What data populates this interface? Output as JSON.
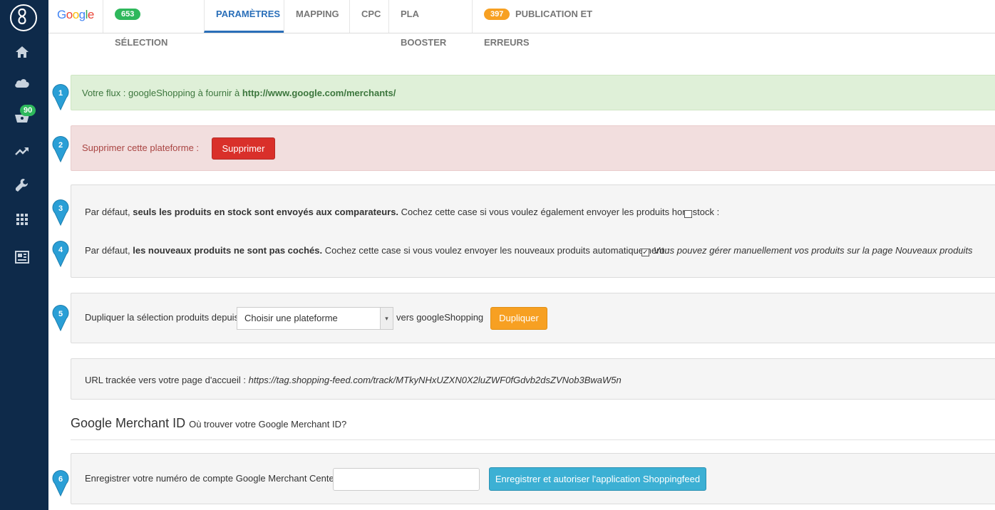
{
  "sidebar": {
    "cart_badge": "90",
    "icons": [
      "logo-icon",
      "home-icon",
      "cloud-icon",
      "basket-icon",
      "trending-icon",
      "wrench-icon",
      "apps-icon",
      "news-icon"
    ]
  },
  "topbar": {
    "logo": "Google",
    "tabs": [
      {
        "count": "653",
        "count_color": "#2eb85c",
        "label": "SÉLECTION"
      },
      {
        "label": "PARAMÈTRES",
        "active": true
      },
      {
        "label": "MAPPING"
      },
      {
        "label": "CPC"
      },
      {
        "label": "PLA BOOSTER"
      },
      {
        "count": "397",
        "count_color": "#f7a022",
        "label": "PUBLICATION ET ERREURS"
      }
    ]
  },
  "steps": [
    "1",
    "2",
    "3",
    "4",
    "5",
    "6"
  ],
  "flux": {
    "prefix": "Votre flux :",
    "name": "googleShopping",
    "middle": "à fournir à",
    "url": "http://www.google.com/merchants/"
  },
  "delete": {
    "label": "Supprimer cette plateforme :",
    "button": "Supprimer"
  },
  "stock": {
    "prefix": "Par défaut,",
    "bold": "seuls les produits en stock sont envoyés aux comparateurs.",
    "suffix": "Cochez cette case si vous voulez également envoyer les produits hors stock :",
    "checked": false
  },
  "new_products": {
    "prefix": "Par défaut,",
    "bold": "les nouveaux produits ne sont pas cochés.",
    "suffix": "Cochez cette case si vous voulez envoyer les nouveaux produits automatiquement :",
    "checked": true,
    "check_glyph": "✓",
    "note": "Vous pouvez gérer manuellement vos produits sur la page Nouveaux produits"
  },
  "duplicate": {
    "label": "Dupliquer la sélection produits depuis",
    "select_value": "Choisir une plateforme",
    "arrow_glyph": "▾",
    "target_prefix": "vers",
    "target": "googleShopping",
    "button": "Dupliquer"
  },
  "tracking": {
    "label": "URL trackée vers votre page d'accueil :",
    "url": "https://tag.shopping-feed.com/track/MTkyNHxUZXN0X2luZWF0fGdvb2dsZVNob3BwaW5n"
  },
  "merchant": {
    "title": "Google Merchant ID",
    "help": "Où trouver votre Google Merchant ID?",
    "label": "Enregistrer votre numéro de compte Google Merchant Center",
    "input_value": "",
    "button": "Enregistrer et autoriser l'application Shoppingfeed"
  },
  "colors": {
    "sidebar": "#0e2a4a",
    "accent": "#2a6fb9",
    "pin": "#2a9fd6"
  }
}
